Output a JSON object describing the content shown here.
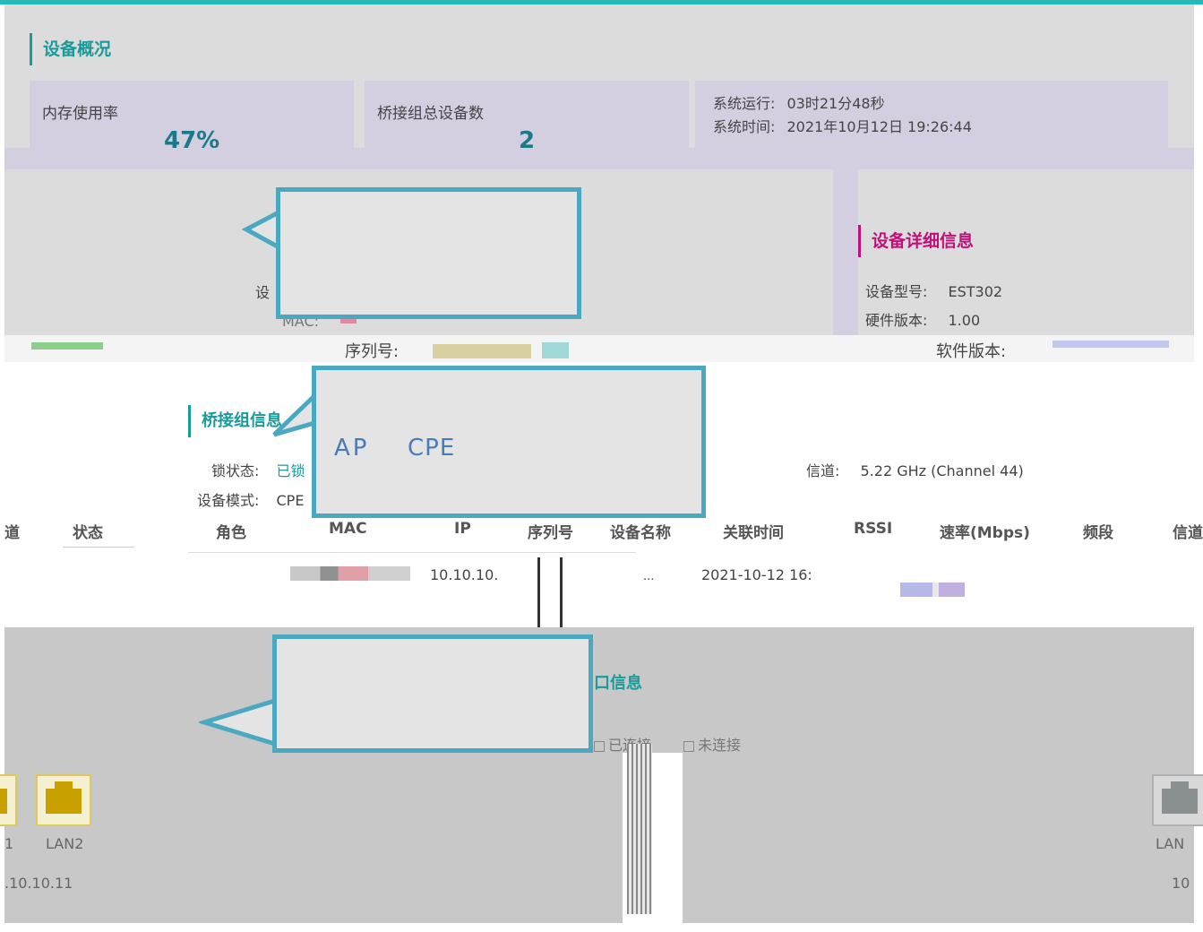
{
  "overview": {
    "title": "设备概况",
    "memory": {
      "label": "内存使用率",
      "value": "47%"
    },
    "bridge_count": {
      "label": "桥接组总设备数",
      "value": "2"
    },
    "system": {
      "uptime_label": "系统运行:",
      "uptime_value": "03时21分48秒",
      "time_label": "系统时间:",
      "time_value": "2021年10月12日 19:26:44"
    }
  },
  "device": {
    "partial_label": "设",
    "mac_label": "MAC:",
    "serial_label": "序列号:",
    "details_title": "设备详细信息",
    "model_label": "设备型号:",
    "model_value": "EST302",
    "hw_label": "硬件版本:",
    "hw_value": "1.00",
    "sw_label": "软件版本:"
  },
  "bridge": {
    "title": "桥接组信息",
    "lock_label": "锁状态:",
    "lock_value": "已锁",
    "mode_label": "设备模式:",
    "mode_value": "CPE",
    "channel_label": "信道:",
    "channel_value": "5.22 GHz (Channel 44)"
  },
  "callouts": {
    "mode_text_ap": "AP",
    "mode_text_cpe": "CPE"
  },
  "table": {
    "headers": [
      "道",
      "状态",
      "角色",
      "MAC",
      "IP",
      "序列号",
      "设备名称",
      "关联时间",
      "RSSI",
      "速率(Mbps)",
      "频段",
      "信道"
    ],
    "row": {
      "ip": "10.10.10.",
      "name": "...",
      "time": "2021-10-12 16:"
    }
  },
  "ports": {
    "title": "口信息",
    "legend_connected": "已连接",
    "legend_disconnected": "未连接",
    "port1_label": "1",
    "port2_label": "LAN2",
    "port2_ip": ".10.10.11",
    "port_right_label": "LAN",
    "port_right_ip": "10"
  },
  "colors": {
    "accent_teal": "#1a9a9a",
    "accent_pink": "#c0107a",
    "callout_border": "#4aa8c0",
    "port_yellow": "#c8a000"
  }
}
